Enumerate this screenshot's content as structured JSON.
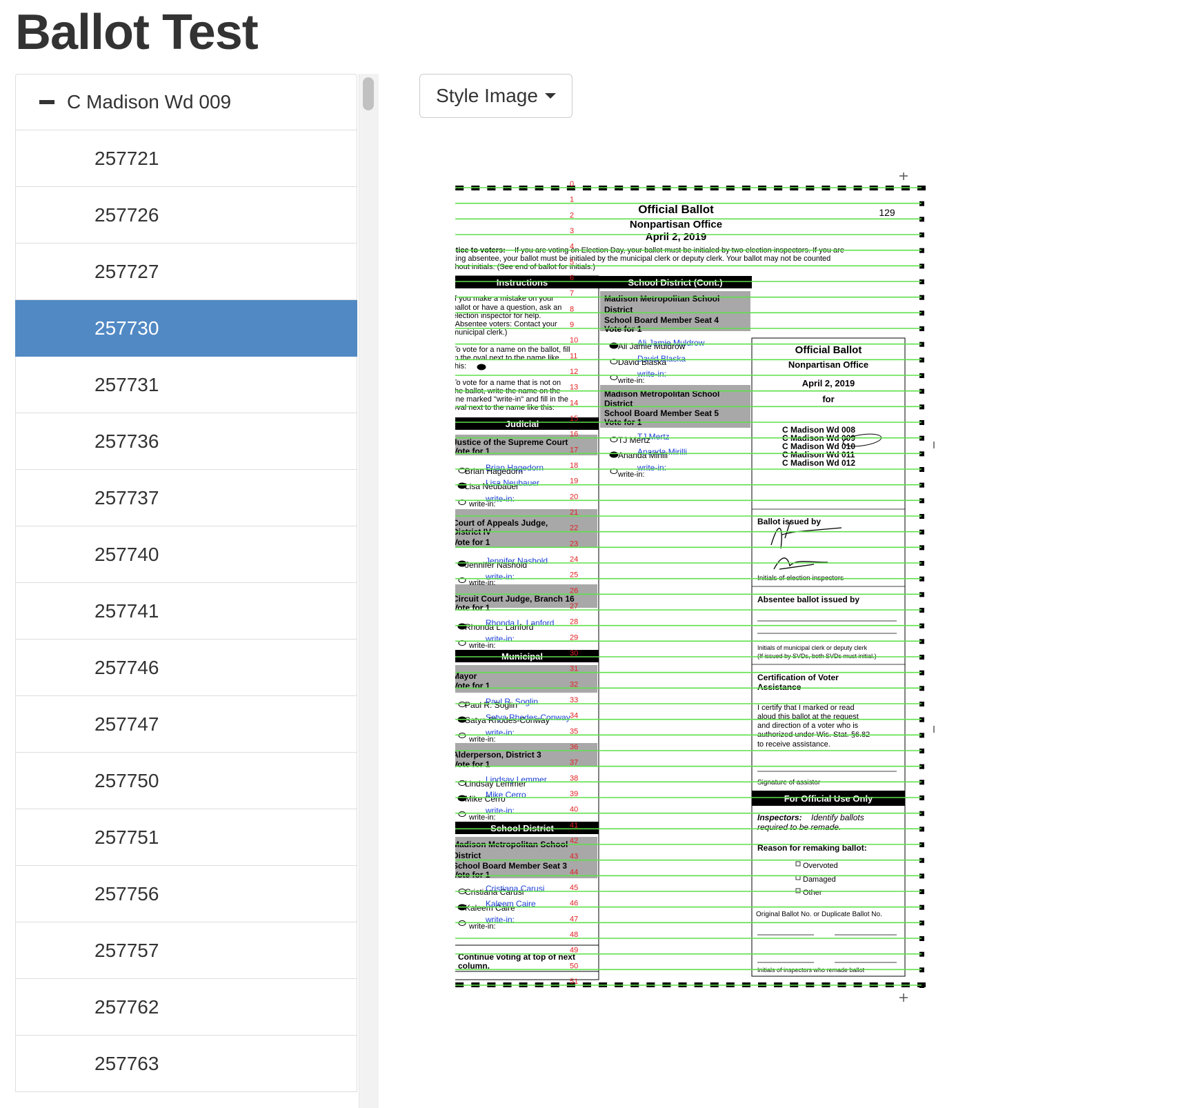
{
  "page_title": "Ballot Test",
  "sidebar": {
    "group_label": "C Madison Wd 009",
    "items": [
      {
        "label": "257721",
        "active": false
      },
      {
        "label": "257726",
        "active": false
      },
      {
        "label": "257727",
        "active": false
      },
      {
        "label": "257730",
        "active": true
      },
      {
        "label": "257731",
        "active": false
      },
      {
        "label": "257736",
        "active": false
      },
      {
        "label": "257737",
        "active": false
      },
      {
        "label": "257740",
        "active": false
      },
      {
        "label": "257741",
        "active": false
      },
      {
        "label": "257746",
        "active": false
      },
      {
        "label": "257747",
        "active": false
      },
      {
        "label": "257750",
        "active": false
      },
      {
        "label": "257751",
        "active": false
      },
      {
        "label": "257756",
        "active": false
      },
      {
        "label": "257757",
        "active": false
      },
      {
        "label": "257762",
        "active": false
      },
      {
        "label": "257763",
        "active": false
      }
    ]
  },
  "toolbar": {
    "style_image_label": "Style Image"
  },
  "ballot": {
    "title": "Official Ballot",
    "subtitle": "Nonpartisan Office",
    "date": "April 2, 2019",
    "number": "129",
    "notice_bold": "Notice to voters:",
    "notice_1": "If you are voting on Election Day, your ballot must be initialed by two election inspectors.  If you are",
    "notice_2": "voting absentee, your ballot must be initialed by the municipal clerk or deputy clerk.  Your ballot may not be counted",
    "notice_3": "without initials.  (See end of ballot for initials.)",
    "instructions_header": "Instructions",
    "instructions_1": [
      "If you make a mistake on your",
      "ballot or have a question, ask an",
      "election inspector for help.",
      "(Absentee voters: Contact your",
      "municipal clerk.)"
    ],
    "instructions_2": [
      "To vote for a name on the ballot, fill",
      "in the oval next to the name like",
      "this:"
    ],
    "instructions_3": [
      "To vote for a name that is not on",
      "the ballot, write the name on the",
      "line marked \"write-in\" and fill in the",
      "oval next to the name like this:"
    ],
    "judicial_header": "Judicial",
    "supreme_title": "Justice of the Supreme Court",
    "vote_for_1": "Vote for 1",
    "brian_printed": "Brian Hagedorn",
    "brian_overlay": "Brian Hagedorn",
    "lisa_printed": "Lisa Neubauer",
    "lisa_overlay": "Lisa Neubauer",
    "write_in": "write-in:",
    "write_in_overlay": "write-in:",
    "appeals_title_1": "Court of Appeals Judge,",
    "appeals_title_2": "District IV",
    "jennifer_printed": "Jennifer Nashold",
    "jennifer_overlay": "Jennifer Nashold",
    "circuit_title": "Circuit Court Judge, Branch 16",
    "rhonda_printed": "Rhonda L. Lanford",
    "rhonda_overlay": "Rhonda L. Lanford",
    "municipal_header": "Municipal",
    "mayor_title": "Mayor",
    "paul_printed": "Paul R. Soglin",
    "paul_overlay": "Paul R. Soglin",
    "satya_printed": "Satya Rhodes-Conway",
    "satya_overlay": "Satya Rhodes-Conway",
    "alder_title": "Alderperson, District 3",
    "lindsay_printed": "Lindsay Lemmer",
    "lindsay_overlay": "Lindsay Lemmer",
    "mike_printed": "Mike Cerro",
    "mike_overlay": "Mike Cerro",
    "school_header": "School District",
    "mmsd_1": "Madison Metropolitan School",
    "mmsd_2": "District",
    "seat3": "School Board Member Seat 3",
    "cristiana_printed": "Cristiana Carusi",
    "cristiana_overlay": "Cristiana Carusi",
    "kaleem_printed": "Kaleem Caire",
    "kaleem_overlay": "Kaleem Caire",
    "continue_1": "Continue voting at top of next",
    "continue_2": "column.",
    "school_cont_header": "School District (Cont.)",
    "seat4": "School Board Member Seat 4",
    "ali_printed": "Ali Jamie Muldrow",
    "ali_overlay": "Ali Jamie Muldrow",
    "david_printed": "David Blaska",
    "david_overlay": "David Blaska",
    "seat5": "School Board Member Seat 5",
    "tj_printed": "TJ Mertz",
    "tj_overlay": "TJ Mertz",
    "ananda_printed": "Ananda Mirilli",
    "ananda_overlay": "Ananda Mirilli",
    "right_title": "Official Ballot",
    "right_subtitle": "Nonpartisan Office",
    "right_date": "April 2, 2019",
    "right_for": "for",
    "wards": [
      "C Madison Wd 008",
      "C Madison Wd 009",
      "C Madison Wd 010",
      "C Madison Wd 011",
      "C Madison Wd 012"
    ],
    "issued_by": "Ballot issued by",
    "initials_inspectors": "Initials of election inspectors",
    "absentee_issued": "Absentee ballot issued by",
    "clerk_initials_1": "Initials of municipal clerk or deputy clerk",
    "clerk_initials_2": "(If issued by SVDs, both SVDs must initial.)",
    "cert_1": "Certification of Voter",
    "cert_2": "Assistance",
    "certify": [
      "I certify that I marked or read",
      "aloud this ballot at the request",
      "and direction of a voter who is",
      "authorized under Wis. Stat. §6.82",
      "to receive assistance."
    ],
    "sig_assistor": "Signature of assistor",
    "official_use": "For Official Use Only",
    "inspectors_bold": "Inspectors:",
    "inspectors_1": "Identify ballots",
    "inspectors_2": "required to be remade.",
    "reason": "Reason for remaking ballot:",
    "overvoted": "Overvoted",
    "damaged": "Damaged",
    "other": "Other",
    "orig_dup": "Original Ballot No.  or  Duplicate Ballot No.",
    "remade_initials": "Initials of inspectors who remade ballot",
    "row_numbers": [
      "0",
      "1",
      "2",
      "3",
      "4",
      "5",
      "6",
      "7",
      "8",
      "9",
      "10",
      "11",
      "12",
      "13",
      "14",
      "15",
      "16",
      "17",
      "18",
      "19",
      "20",
      "21",
      "22",
      "23",
      "24",
      "25",
      "26",
      "27",
      "28",
      "29",
      "30",
      "31",
      "32",
      "33",
      "34",
      "35",
      "36",
      "37",
      "38",
      "39",
      "40",
      "41",
      "42",
      "43",
      "44",
      "45",
      "46",
      "47",
      "48",
      "49",
      "50",
      "51"
    ],
    "edge_labels": [
      "11",
      "21",
      "40",
      "42",
      "43",
      "49",
      "51"
    ]
  }
}
